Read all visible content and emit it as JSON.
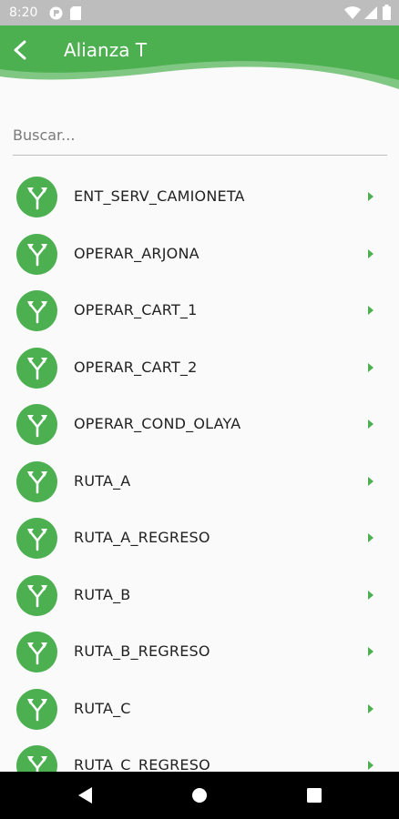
{
  "status_bar": {
    "time": "8:20"
  },
  "app_bar": {
    "title": "Alianza T"
  },
  "search": {
    "placeholder": "Buscar..."
  },
  "routes": [
    {
      "label": "ENT_SERV_CAMIONETA"
    },
    {
      "label": "OPERAR_ARJONA"
    },
    {
      "label": "OPERAR_CART_1"
    },
    {
      "label": "OPERAR_CART_2"
    },
    {
      "label": "OPERAR_COND_OLAYA"
    },
    {
      "label": "RUTA_A"
    },
    {
      "label": "RUTA_A_REGRESO"
    },
    {
      "label": "RUTA_B"
    },
    {
      "label": "RUTA_B_REGRESO"
    },
    {
      "label": "RUTA_C"
    },
    {
      "label": "RUTA_C_REGRESO"
    }
  ],
  "icons": {
    "back": "arrow-back-icon",
    "route": "route-merge-icon",
    "chevron": "chevron-right-icon",
    "nav_back": "triangle-back-icon",
    "nav_home": "circle-home-icon",
    "nav_recents": "square-recents-icon"
  },
  "colors": {
    "primary": "#4caf50",
    "primary_light": "#81c784",
    "status_bar": "#bdbdbd",
    "background": "#fafafa",
    "text": "#222222"
  }
}
